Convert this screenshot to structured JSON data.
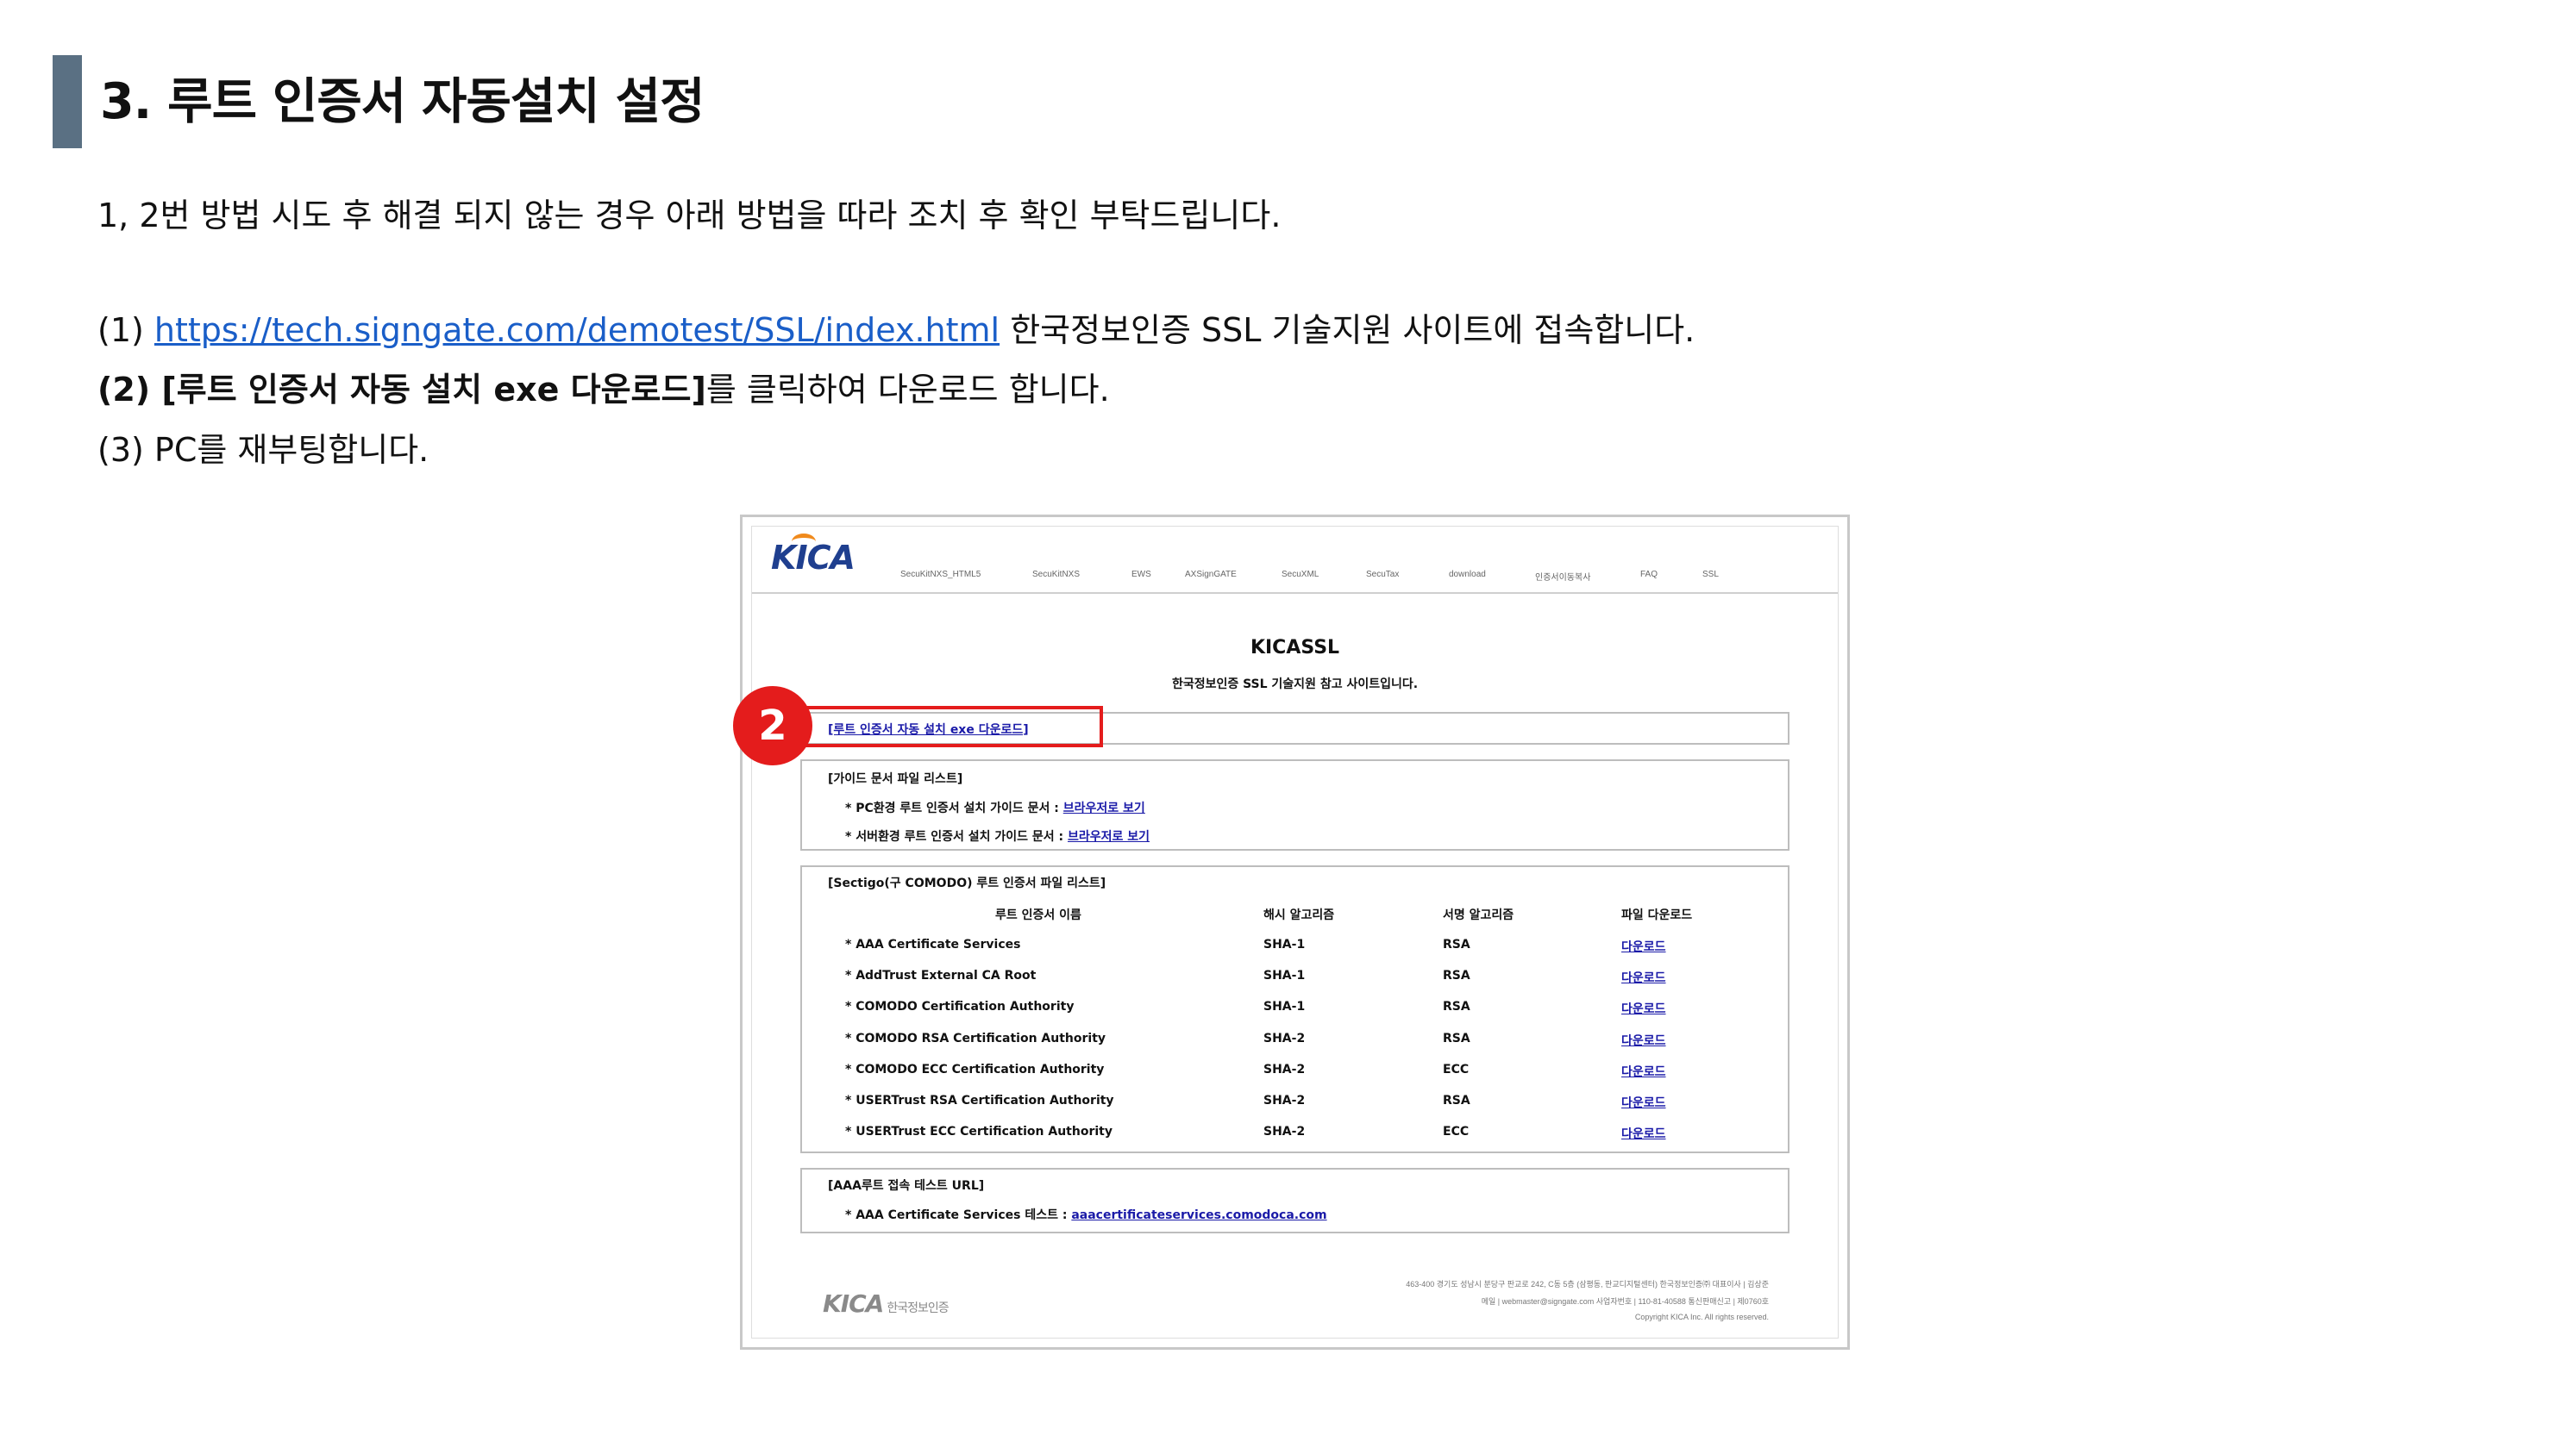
{
  "title": "3. 루트 인증서 자동설치 설정",
  "intro": "1, 2번 방법 시도 후 해결 되지 않는 경우 아래 방법을 따라 조치 후 확인 부탁드립니다.",
  "steps": {
    "s1_prefix": "(1) ",
    "s1_link": "https://tech.signgate.com/demotest/SSL/index.html",
    "s1_suffix": " 한국정보인증 SSL 기술지원 사이트에 접속합니다.",
    "s2_bold": "(2) [루트 인증서 자동 설치 exe 다운로드]",
    "s2_suffix": "를 클릭하여 다운로드 합니다.",
    "s3": "(3) PC를 재부팅합니다."
  },
  "shot": {
    "logo": "KICA",
    "nav": [
      "SecuKitNXS_HTML5",
      "SecuKitNXS",
      "EWS",
      "AXSignGATE",
      "SecuXML",
      "SecuTax",
      "download",
      "인증서이동복사",
      "FAQ",
      "SSL"
    ],
    "site_title": "KICASSL",
    "site_subtitle": "한국정보인증 SSL 기술지원 참고 사이트입니다.",
    "auto_install_link": "[루트 인증서 자동 설치 exe 다운로드]",
    "badge": "2",
    "guide": {
      "heading": "[가이드 문서 파일 리스트]",
      "pc_label": "* PC환경 루트 인증서 설치 가이드 문서 : ",
      "pc_link": "브라우저로 보기",
      "server_label": "* 서버환경 루트 인증서 설치 가이드 문서 : ",
      "server_link": "브라우저로 보기"
    },
    "sectigo": {
      "heading": "[Sectigo(구 COMODO) 루트 인증서 파일 리스트]",
      "columns": [
        "루트 인증서 이름",
        "해시 알고리즘",
        "서명 알고리즘",
        "파일 다운로드"
      ],
      "rows": [
        {
          "name": "* AAA Certificate Services",
          "hash": "SHA-1",
          "sign": "RSA",
          "dl": "다운로드"
        },
        {
          "name": "* AddTrust External CA Root",
          "hash": "SHA-1",
          "sign": "RSA",
          "dl": "다운로드"
        },
        {
          "name": "* COMODO Certification Authority",
          "hash": "SHA-1",
          "sign": "RSA",
          "dl": "다운로드"
        },
        {
          "name": "* COMODO RSA Certification Authority",
          "hash": "SHA-2",
          "sign": "RSA",
          "dl": "다운로드"
        },
        {
          "name": "* COMODO ECC Certification Authority",
          "hash": "SHA-2",
          "sign": "ECC",
          "dl": "다운로드"
        },
        {
          "name": "* USERTrust RSA Certification Authority",
          "hash": "SHA-2",
          "sign": "RSA",
          "dl": "다운로드"
        },
        {
          "name": "* USERTrust ECC Certification Authority",
          "hash": "SHA-2",
          "sign": "ECC",
          "dl": "다운로드"
        }
      ]
    },
    "aaa": {
      "heading": "[AAA루트 접속 테스트 URL]",
      "label": "* AAA Certificate Services 테스트 : ",
      "link": "aaacertificateservices.comodoca.com"
    },
    "footer": {
      "logo": "KICA",
      "logo_text": "한국정보인증",
      "line1": "463-400 경기도 성남시 분당구 판교로 242, C동 5층 (삼평동, 판교디지털센터) 한국정보인증㈜    대표이사 | 김상준",
      "line2": "메일 | webmaster@signgate.com    사업자번호 | 110-81-40588    통신판매신고 | 제0760호",
      "line3": "Copyright KICA Inc. All rights reserved."
    }
  }
}
